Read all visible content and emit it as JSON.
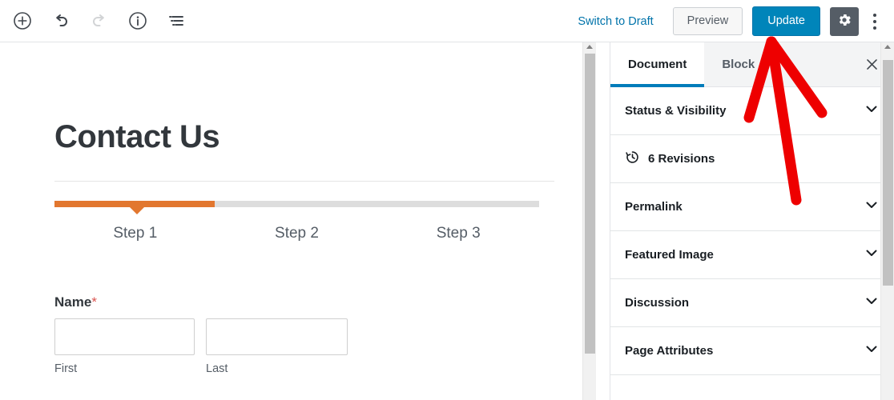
{
  "header": {
    "left_tools": [
      {
        "name": "add-block-icon",
        "label": "Add block"
      },
      {
        "name": "undo-icon",
        "label": "Undo"
      },
      {
        "name": "redo-icon",
        "label": "Redo"
      },
      {
        "name": "info-icon",
        "label": "Content structure"
      },
      {
        "name": "list-view-icon",
        "label": "Block navigation"
      }
    ],
    "switch_to_draft": "Switch to Draft",
    "preview_label": "Preview",
    "update_label": "Update",
    "settings_icon": "gear-icon",
    "more_menu_icon": "more-vertical-icon"
  },
  "canvas": {
    "post_title": "Contact Us",
    "form": {
      "progress": {
        "fill_percent": 33,
        "pointer_percent": 17,
        "fill_color": "#e2772f",
        "track_color": "#dddddd",
        "steps": [
          "Step 1",
          "Step 2",
          "Step 3"
        ]
      },
      "fields": [
        {
          "label": "Name",
          "required_mark": "*",
          "inputs": [
            {
              "name": "first-name-input",
              "value": "",
              "placeholder": "",
              "sub_label": "First"
            },
            {
              "name": "last-name-input",
              "value": "",
              "placeholder": "",
              "sub_label": "Last"
            }
          ]
        }
      ]
    }
  },
  "sidebar": {
    "tabs": [
      {
        "label": "Document",
        "active": true
      },
      {
        "label": "Block",
        "active": false
      }
    ],
    "close_icon": "close-icon",
    "panels": [
      {
        "label": "Status & Visibility",
        "type": "accordion"
      },
      {
        "label": "6 Revisions",
        "type": "link",
        "icon": "revisions-clock-icon"
      },
      {
        "label": "Permalink",
        "type": "accordion"
      },
      {
        "label": "Featured Image",
        "type": "accordion"
      },
      {
        "label": "Discussion",
        "type": "accordion"
      },
      {
        "label": "Page Attributes",
        "type": "accordion"
      }
    ]
  },
  "annotation": {
    "type": "arrow",
    "color": "#ee0000",
    "points_at": "update-button"
  },
  "colors": {
    "accent_blue": "#0085ba",
    "link_blue": "#0073aa",
    "tab_underline": "#007cba",
    "orange": "#e2772f",
    "gear_bg": "#555d66",
    "required_red": "#d9534f",
    "annotation_red": "#ee0000"
  }
}
